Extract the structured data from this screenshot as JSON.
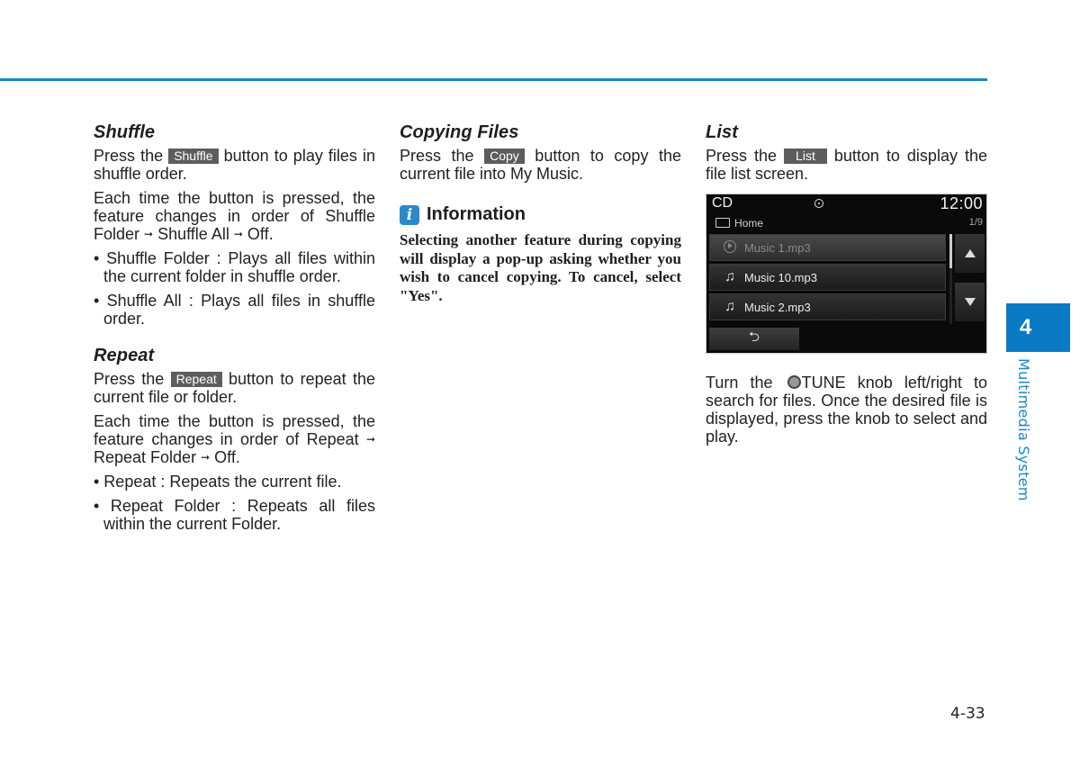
{
  "page": {
    "chapter_number": "4",
    "chapter_title": "Multimedia System",
    "page_number": "4-33",
    "accent_color": "#1a87c9"
  },
  "shuffle": {
    "title": "Shuffle",
    "p1_before": "Press the ",
    "button": "Shuffle",
    "p1_after": " button to play files in shuffle order.",
    "p2_a": "Each time the button is pressed, the feature changes in order of Shuffle Folder ",
    "p2_b": " Shuffle All ",
    "p2_c": " Off.",
    "arrow": "➞",
    "bullets": [
      "• Shuffle Folder : Plays all files within the current folder in shuffle order.",
      "• Shuffle All : Plays all files in shuffle order."
    ]
  },
  "repeat": {
    "title": "Repeat",
    "p1_before": "Press the ",
    "button": "Repeat",
    "p1_after": " button to repeat the current file or folder.",
    "p2_a": "Each time the button is pressed, the feature changes in order of Repeat ",
    "p2_b": " Repeat Folder ",
    "p2_c": " Off.",
    "arrow": "➞",
    "bullets": [
      "• Repeat : Repeats the current file.",
      "• Repeat Folder : Repeats all files within the current Folder."
    ]
  },
  "copying": {
    "title": "Copying Files",
    "p1_before": "Press the ",
    "button": "Copy",
    "p1_after": " button to copy the current file into My Music.",
    "info_icon": "i",
    "info_title": "Information",
    "info_body": "Selecting another feature during copying will display a pop-up asking whether you wish to cancel copying. To cancel, select \"Yes\"."
  },
  "list": {
    "title": "List",
    "p1_before": "Press the ",
    "button": "List",
    "p1_after": " button to display the file list screen.",
    "p2_before": "Turn the ",
    "p2_after": "TUNE knob left/right to search for files. Once the desired file is displayed, press the knob to select and play.",
    "screen": {
      "source": "CD",
      "time": "12:00",
      "folder": "Home",
      "count": "1/9",
      "files": [
        {
          "name": "Music 1.mp3",
          "icon": "play-icon",
          "active": true
        },
        {
          "name": "Music 10.mp3",
          "icon": "music-note-icon",
          "active": false
        },
        {
          "name": "Music 2.mp3",
          "icon": "music-note-icon",
          "active": false
        }
      ],
      "back_glyph": "⮌"
    }
  }
}
